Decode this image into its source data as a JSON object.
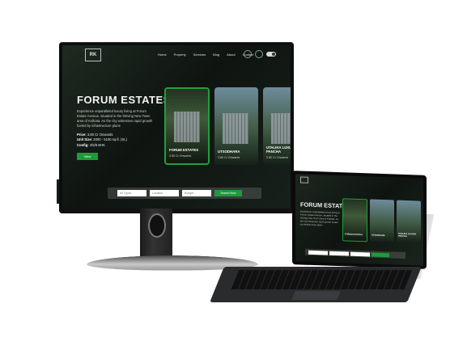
{
  "site": {
    "logo_text": "RK",
    "nav": [
      "Home",
      "Property",
      "Services",
      "Blog",
      "About",
      "Contact"
    ]
  },
  "hero": {
    "title": "FORUM ESTATES",
    "description": "Experience unparalleled luxury living at Forum Estate Avenue, situated in the thriving New Town area of Kolkata. As the city witnesses rapid growth fueled by infrastructure plans",
    "price_label": "Price:",
    "price_value": "3.80 Cr Onwards",
    "unit_label": "Unit Size:",
    "unit_value": "2000 - 5100 sq.ft. (SL)",
    "config_label": "Config:",
    "config_value": "4/5/6 BHK",
    "cta": "View"
  },
  "cards": [
    {
      "title": "FORUM ESTATES",
      "sub": "3.80 Cr Onwards"
    },
    {
      "title": "UTSODHARA",
      "sub": "3.80 Cr Onwards"
    },
    {
      "title": "UTALIKA LUXURY PANCHA",
      "sub": "3.80 Cr Onwards"
    }
  ],
  "search": {
    "field1": "All Types",
    "field2": "Location",
    "field3": "Budget",
    "button": "Search Now"
  },
  "tablet": {
    "title": "FORUM ESTATES"
  },
  "colors": {
    "accent": "#1e9a3a",
    "dark": "#0f1411"
  }
}
